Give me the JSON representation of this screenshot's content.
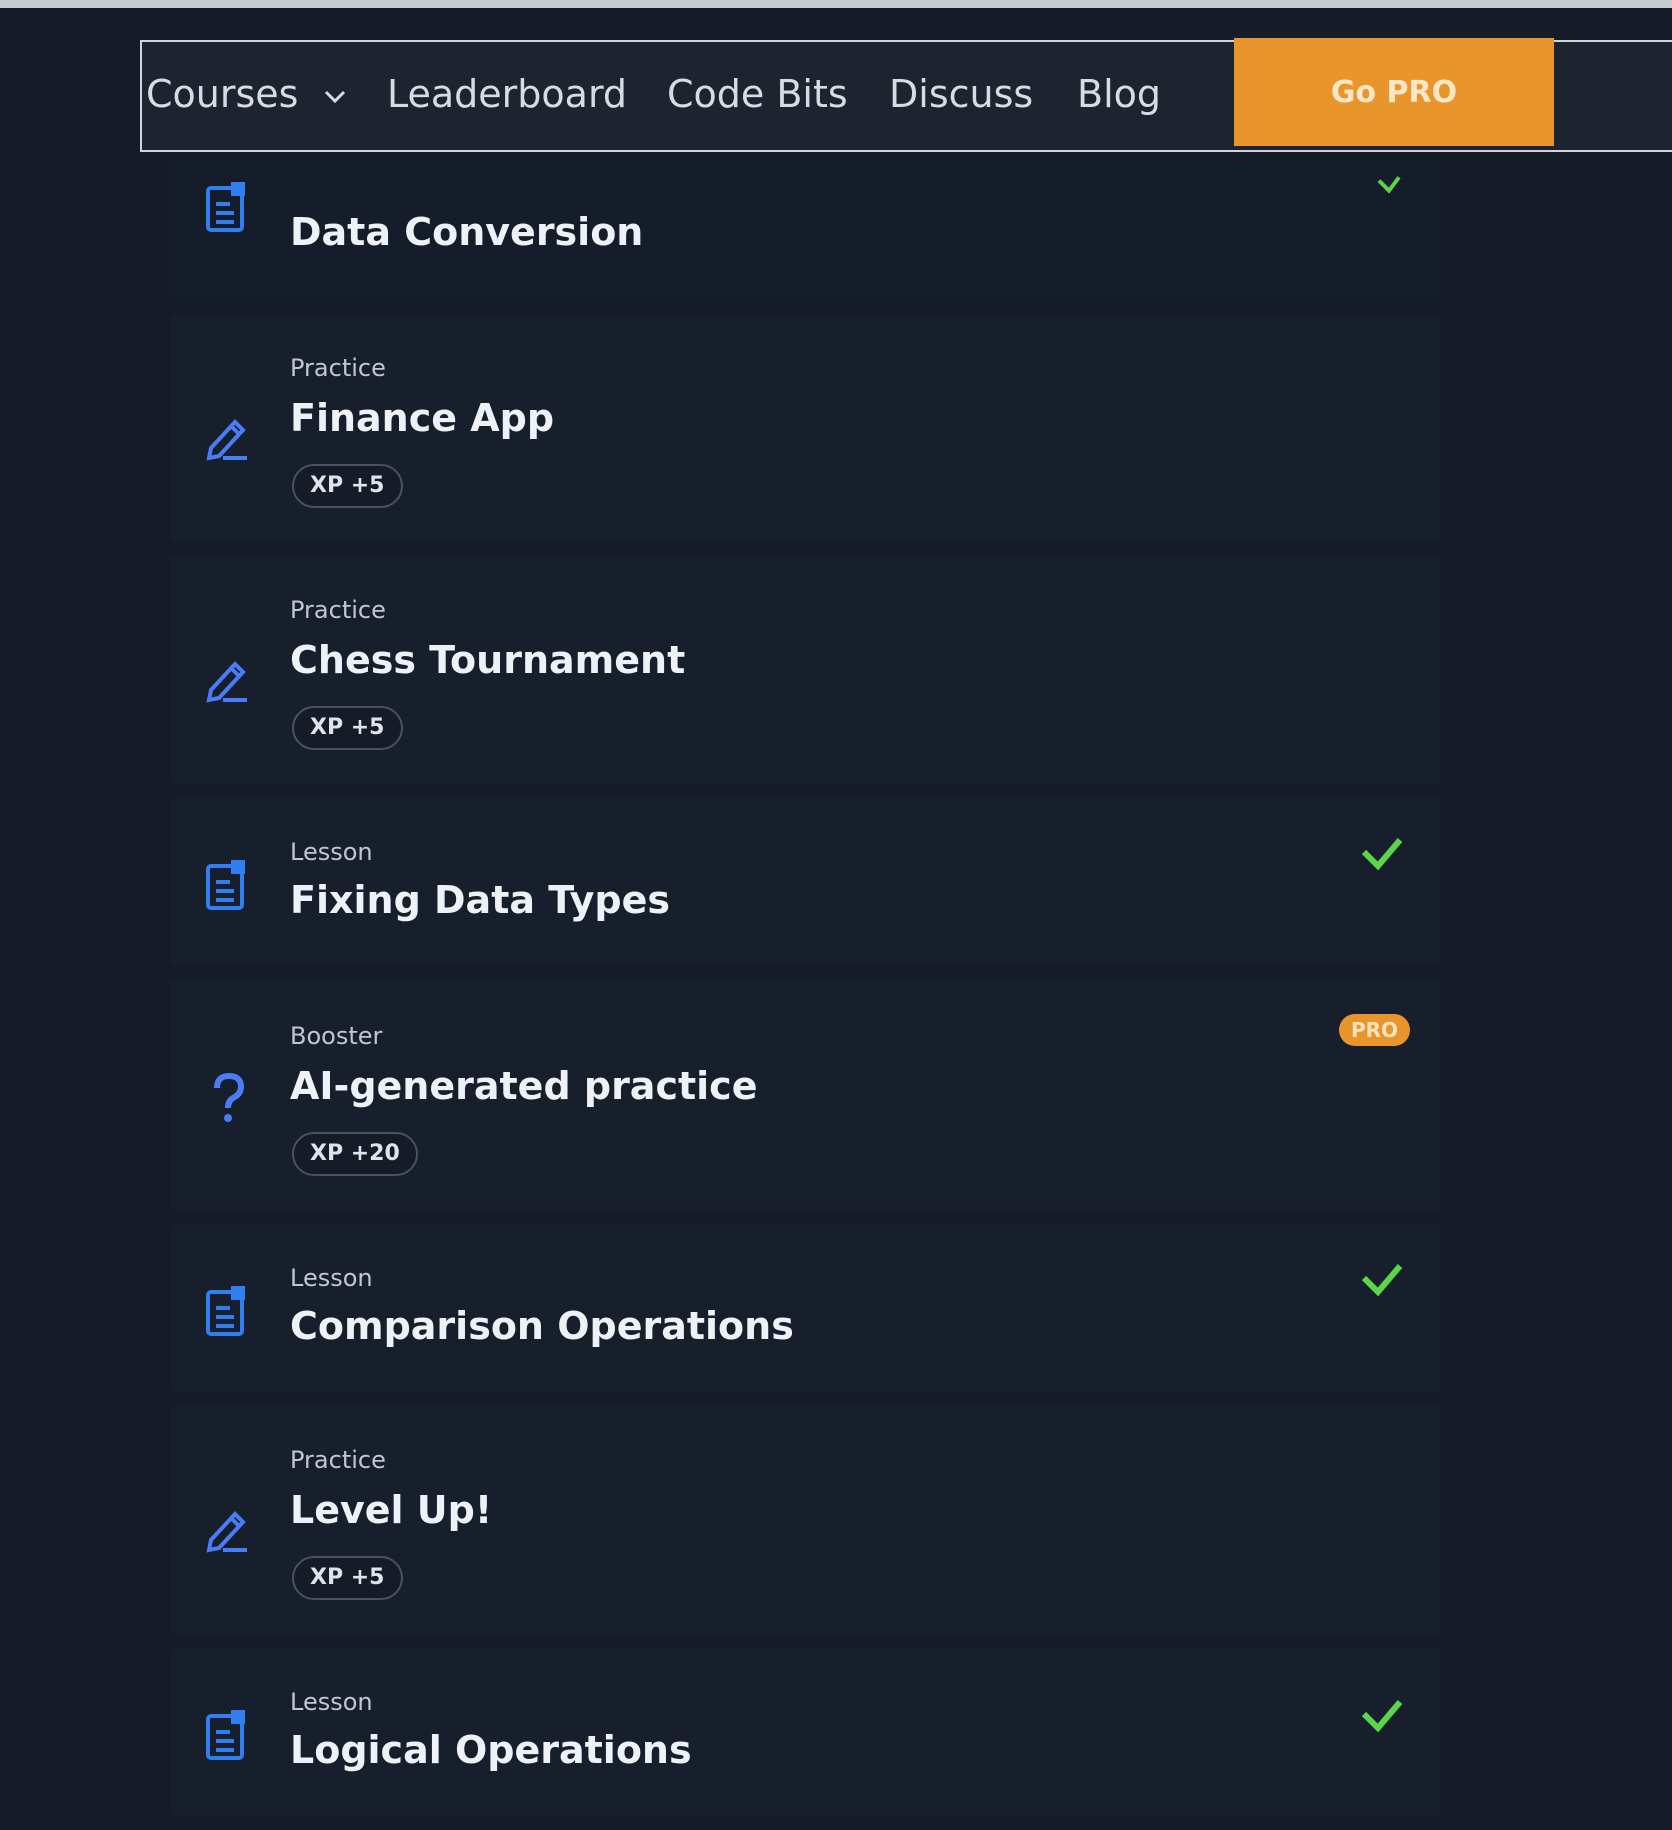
{
  "nav": {
    "courses": "Courses",
    "leaderboard": "Leaderboard",
    "code_bits": "Code Bits",
    "discuss": "Discuss",
    "blog": "Blog",
    "go_pro": "Go PRO"
  },
  "header_item": {
    "title": "Data Conversion",
    "completed": true
  },
  "items": [
    {
      "type": "Practice",
      "title": "Finance App",
      "xp": "XP +5"
    },
    {
      "type": "Practice",
      "title": "Chess Tournament",
      "xp": "XP +5"
    },
    {
      "type": "Lesson",
      "title": "Fixing Data Types",
      "completed": true
    },
    {
      "type": "Booster",
      "title": "AI-generated practice",
      "xp": "XP +20",
      "badge": "PRO"
    },
    {
      "type": "Lesson",
      "title": "Comparison Operations",
      "completed": true
    },
    {
      "type": "Practice",
      "title": "Level Up!",
      "xp": "XP +5"
    },
    {
      "type": "Lesson",
      "title": "Logical Operations",
      "completed": true
    }
  ],
  "colors": {
    "accent_orange": "#e8962c",
    "icon_blue": "#2f7ff0",
    "check_green": "#5bd64a",
    "background": "#151c28"
  }
}
